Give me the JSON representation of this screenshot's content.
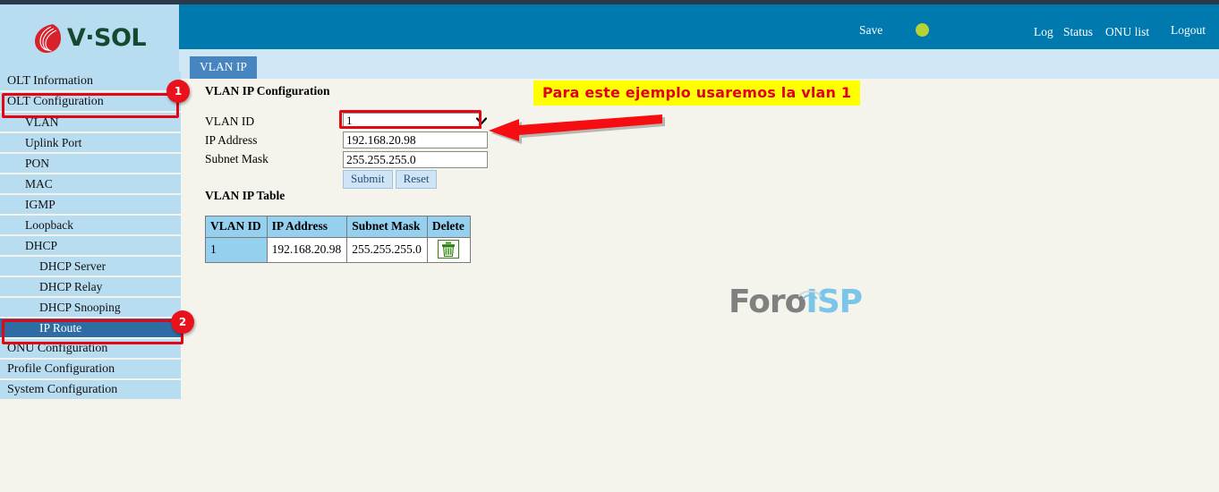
{
  "brand": {
    "logo_text": "V·SOL",
    "logo_mark": "flame-icon"
  },
  "header": {
    "save_label": "Save",
    "status_dot": "status-indicator-green",
    "status_dot_color": "#b5d334",
    "links": [
      {
        "label": "Log"
      },
      {
        "label": "Status"
      },
      {
        "label": "ONU list"
      },
      {
        "label": "Logout"
      }
    ],
    "bar_color": "#0079ae"
  },
  "tab": {
    "active_label": "VLAN IP"
  },
  "sidebar": {
    "items": [
      {
        "label": "OLT Information",
        "level": 0,
        "selected": false
      },
      {
        "label": "OLT Configuration",
        "level": 0,
        "selected": false
      },
      {
        "label": "VLAN",
        "level": 1,
        "selected": false
      },
      {
        "label": "Uplink Port",
        "level": 1,
        "selected": false
      },
      {
        "label": "PON",
        "level": 1,
        "selected": false
      },
      {
        "label": "MAC",
        "level": 1,
        "selected": false
      },
      {
        "label": "IGMP",
        "level": 1,
        "selected": false
      },
      {
        "label": "Loopback",
        "level": 1,
        "selected": false
      },
      {
        "label": "DHCP",
        "level": 1,
        "selected": false
      },
      {
        "label": "DHCP Server",
        "level": 2,
        "selected": false
      },
      {
        "label": "DHCP Relay",
        "level": 2,
        "selected": false
      },
      {
        "label": "DHCP Snooping",
        "level": 2,
        "selected": false
      },
      {
        "label": "IP Route",
        "level": 2,
        "selected": true
      },
      {
        "label": "ONU Configuration",
        "level": 0,
        "selected": false
      },
      {
        "label": "Profile Configuration",
        "level": 0,
        "selected": false
      },
      {
        "label": "System Configuration",
        "level": 0,
        "selected": false
      }
    ]
  },
  "main": {
    "config_title": "VLAN IP Configuration",
    "table_title": "VLAN IP Table",
    "form": {
      "vlan_id_label": "VLAN ID",
      "vlan_id_value": "1",
      "vlan_id_options": [
        "1"
      ],
      "ip_label": "IP Address",
      "ip_value": "192.168.20.98",
      "mask_label": "Subnet Mask",
      "mask_value": "255.255.255.0",
      "submit_label": "Submit",
      "reset_label": "Reset"
    },
    "table": {
      "columns": [
        "VLAN ID",
        "IP Address",
        "Subnet Mask",
        "Delete"
      ],
      "rows": [
        {
          "vlan_id": "1",
          "ip_address": "192.168.20.98",
          "subnet_mask": "255.255.255.0",
          "delete_icon": "trash-icon"
        }
      ]
    }
  },
  "annotations": {
    "note_text": "Para este ejemplo usaremos la vlan 1",
    "note_bg": "#ffff00",
    "note_color": "#e2001a",
    "badge_1": "1",
    "badge_2": "2",
    "highlight_color": "#e30613",
    "arrow": "left-arrow-icon"
  },
  "watermark": {
    "part_gray": "Foro",
    "part_blue": "ISP",
    "wifi_icon": "wifi-arc-icon"
  }
}
